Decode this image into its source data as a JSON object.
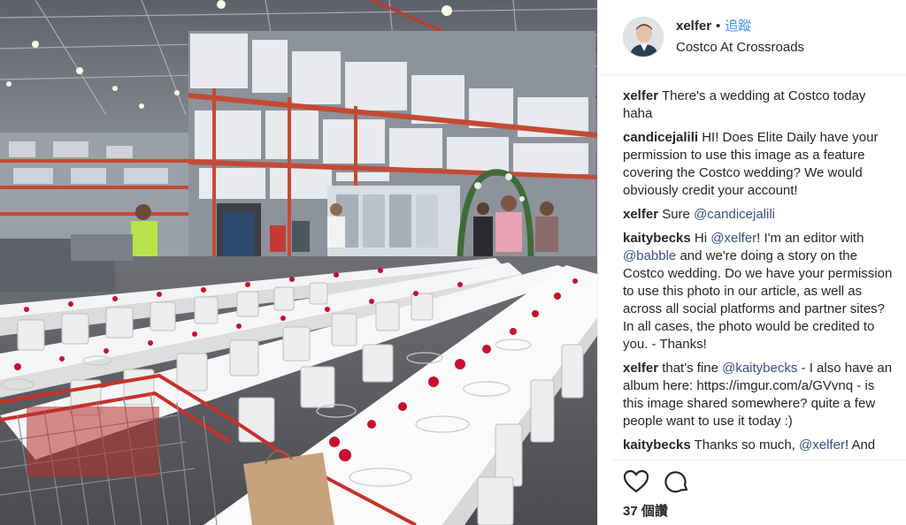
{
  "post": {
    "username": "xelfer",
    "dot": "•",
    "follow_label": "追蹤",
    "location": "Costco At Crossroads"
  },
  "comments": [
    {
      "author": "xelfer",
      "parts": [
        {
          "t": "There's a wedding at Costco today haha"
        }
      ]
    },
    {
      "author": "candicejalili",
      "parts": [
        {
          "t": "HI! Does Elite Daily have your permission to use this image as a feature covering the Costco wedding? We would obviously credit your account!"
        }
      ]
    },
    {
      "author": "xelfer",
      "parts": [
        {
          "t": "Sure "
        },
        {
          "m": "@candicejalili"
        }
      ]
    },
    {
      "author": "kaitybecks",
      "parts": [
        {
          "t": "Hi "
        },
        {
          "m": "@xelfer"
        },
        {
          "t": "! I'm an editor with "
        },
        {
          "m": "@babble"
        },
        {
          "t": " and we're doing a story on the Costco wedding. Do we have your permission to use this photo in our article, as well as across all social platforms and partner sites? In all cases, the photo would be credited to you. - Thanks!"
        }
      ]
    },
    {
      "author": "xelfer",
      "parts": [
        {
          "t": "that's fine "
        },
        {
          "m": "@kaitybecks"
        },
        {
          "t": " - I also have an album here: https://imgur.com/a/GVvnq - is this image shared somewhere? quite a few people want to use it today :)"
        }
      ]
    },
    {
      "author": "kaitybecks",
      "parts": [
        {
          "t": "Thanks so much, "
        },
        {
          "m": "@xelfer"
        },
        {
          "t": "! And"
        }
      ]
    }
  ],
  "likes_label": "37 個讚",
  "icons": {
    "like": "heart-icon",
    "comment": "comment-icon"
  },
  "colors": {
    "link": "#3897f0",
    "mention": "#385185",
    "text": "#262626"
  }
}
